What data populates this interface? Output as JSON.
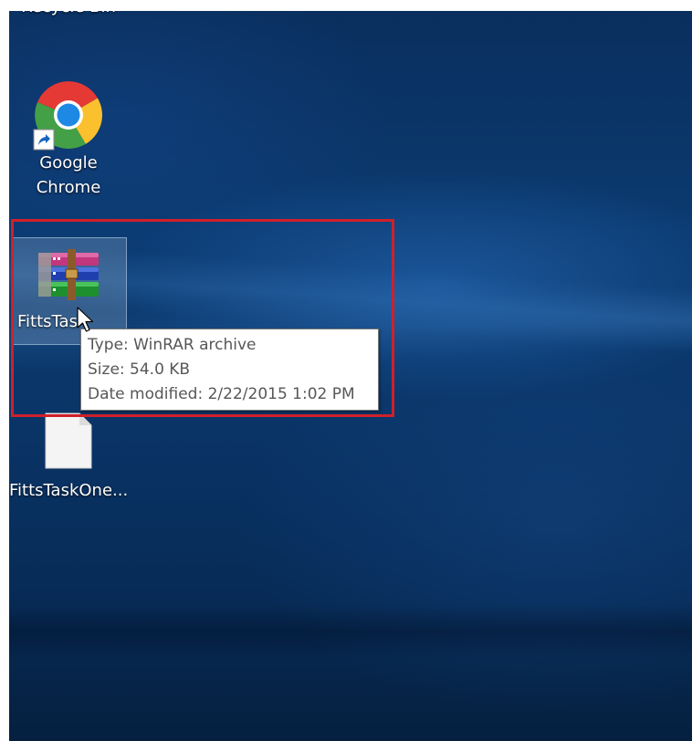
{
  "desktop": {
    "icons": [
      {
        "id": "recycle-bin",
        "label": "Recycle Bin",
        "icon": "recycle-bin-icon"
      },
      {
        "id": "google-chrome",
        "label": "Google Chrome",
        "label_lines": [
          "Google",
          "Chrome"
        ],
        "icon": "chrome-icon",
        "shortcut": true
      },
      {
        "id": "rar-archive",
        "label": "FittsTas",
        "icon": "winrar-archive-icon",
        "selected": true
      },
      {
        "id": "text-file",
        "label": "FittsTaskOne...",
        "icon": "blank-file-icon"
      }
    ]
  },
  "tooltip": {
    "type": "Type: WinRAR archive",
    "size": "Size: 54.0 KB",
    "date_modified": "Date modified: 2/22/2015 1:02 PM"
  },
  "colors": {
    "highlight_box": "#d0202a",
    "desktop_background": "#0b3a70",
    "tooltip_text": "#575757"
  }
}
